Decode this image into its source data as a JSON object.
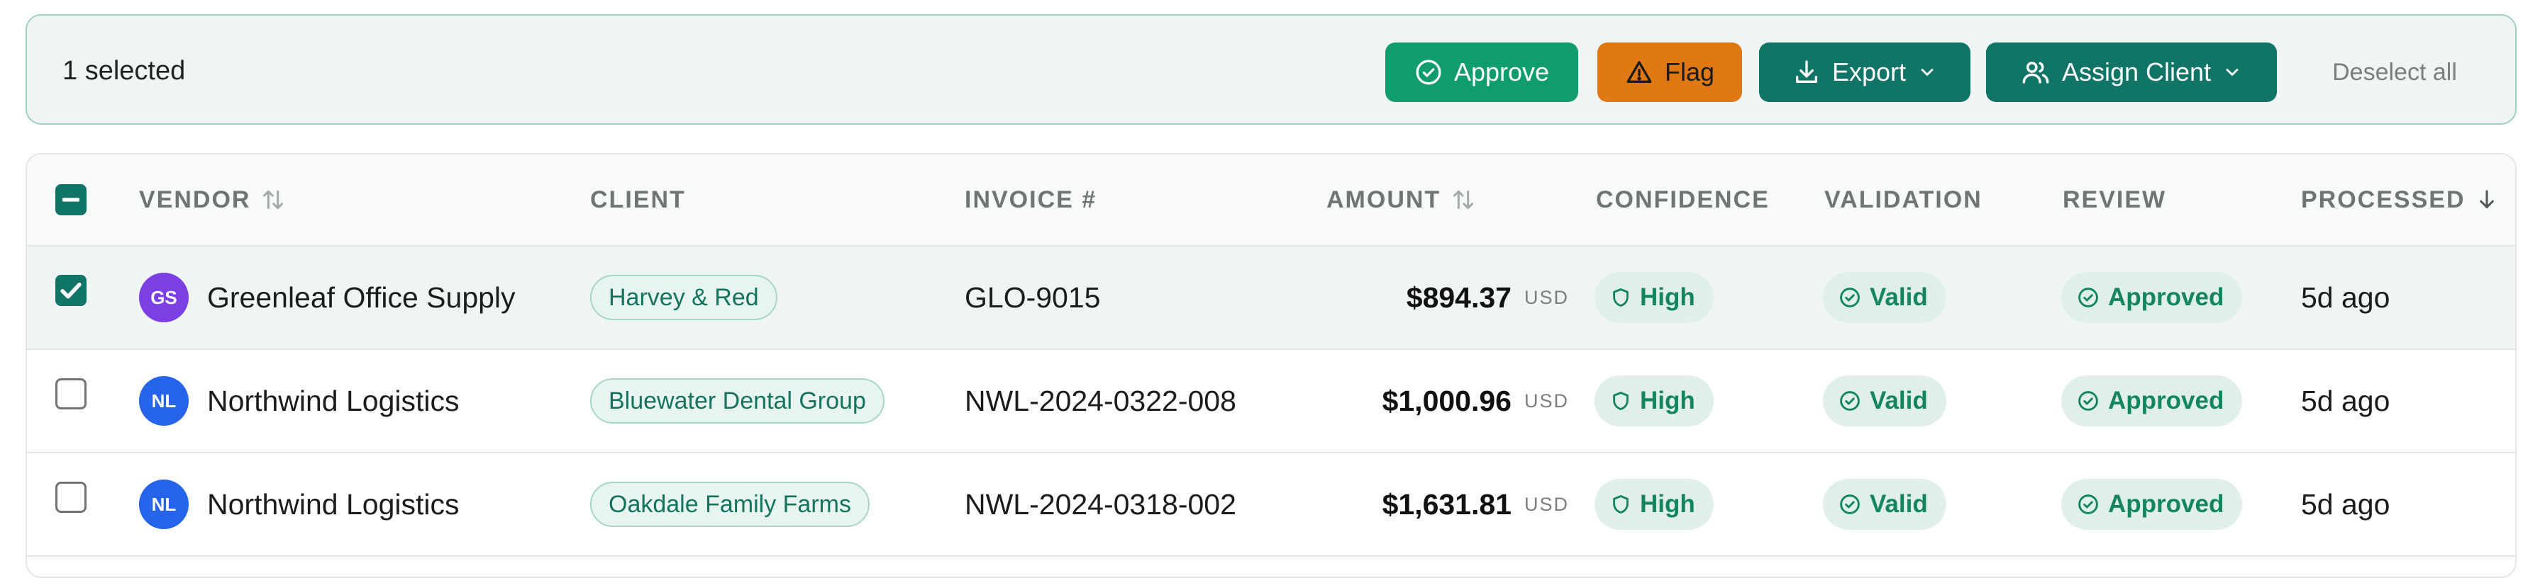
{
  "selection_bar": {
    "count_text": "1 selected",
    "approve_label": "Approve",
    "flag_label": "Flag",
    "export_label": "Export",
    "assign_label": "Assign Client",
    "deselect_label": "Deselect all"
  },
  "columns": {
    "vendor": "VENDOR",
    "client": "CLIENT",
    "invoice": "INVOICE #",
    "amount": "AMOUNT",
    "confidence": "CONFIDENCE",
    "validation": "VALIDATION",
    "review": "REVIEW",
    "processed": "PROCESSED"
  },
  "rows": [
    {
      "selected": true,
      "initials": "GS",
      "avatar_color": "#7b3fe4",
      "vendor": "Greenleaf Office Supply",
      "client": "Harvey & Red",
      "invoice": "GLO-9015",
      "amount": "$894.37",
      "currency": "USD",
      "confidence": "High",
      "validation": "Valid",
      "review": "Approved",
      "processed": "5d ago"
    },
    {
      "selected": false,
      "initials": "NL",
      "avatar_color": "#2563eb",
      "vendor": "Northwind Logistics",
      "client": "Bluewater Dental Group",
      "invoice": "NWL-2024-0322-008",
      "amount": "$1,000.96",
      "currency": "USD",
      "confidence": "High",
      "validation": "Valid",
      "review": "Approved",
      "processed": "5d ago"
    },
    {
      "selected": false,
      "initials": "NL",
      "avatar_color": "#2563eb",
      "vendor": "Northwind Logistics",
      "client": "Oakdale Family Farms",
      "invoice": "NWL-2024-0318-002",
      "amount": "$1,631.81",
      "currency": "USD",
      "confidence": "High",
      "validation": "Valid",
      "review": "Approved",
      "processed": "5d ago"
    }
  ],
  "icons": {
    "approve": "check-circle-icon",
    "flag": "warning-triangle-icon",
    "export": "download-icon",
    "assign": "users-icon",
    "sort": "sort-arrows-icon",
    "sort_desc": "arrow-down-icon",
    "confidence": "shield-icon",
    "status": "check-circle-icon"
  },
  "colors": {
    "approve": "#0f9d6e",
    "flag": "#e07914",
    "primary": "#107466",
    "badge_bg": "#e0efea",
    "badge_text": "#13855f"
  }
}
